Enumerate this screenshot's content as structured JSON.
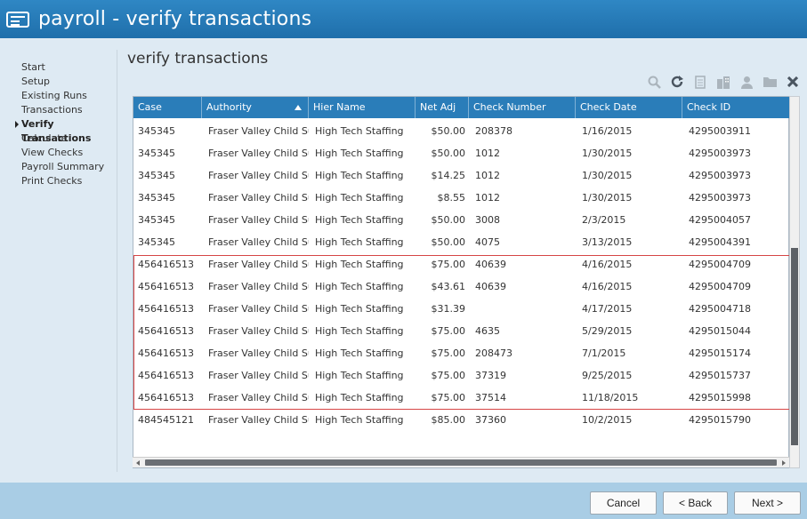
{
  "app": {
    "title": "payroll - verify transactions",
    "icon": "payroll-card-icon"
  },
  "sidebar": {
    "items": [
      {
        "label": "Start",
        "active": false
      },
      {
        "label": "Setup",
        "active": false
      },
      {
        "label": "Existing Runs",
        "active": false
      },
      {
        "label": "Transactions",
        "active": false
      },
      {
        "label": "Verify Transactions",
        "active": true
      },
      {
        "label": "Calculate",
        "active": false
      },
      {
        "label": "View Checks",
        "active": false
      },
      {
        "label": "Payroll Summary",
        "active": false
      },
      {
        "label": "Print Checks",
        "active": false
      }
    ]
  },
  "main": {
    "title": "verify transactions",
    "toolbar": {
      "icons": [
        "search-icon",
        "refresh-icon",
        "document-icon",
        "building-icon",
        "person-icon",
        "folder-icon",
        "close-icon"
      ]
    },
    "grid": {
      "columns": [
        "Case",
        "Authority",
        "Hier Name",
        "Net Adj",
        "Check Number",
        "Check Date",
        "Check ID"
      ],
      "sorted_column": "Authority",
      "rows": [
        [
          "345345",
          "Fraser Valley Child Su...",
          "High Tech Staffing",
          "$50.00",
          "208378",
          "1/16/2015",
          "4295003911"
        ],
        [
          "345345",
          "Fraser Valley Child Su...",
          "High Tech Staffing",
          "$50.00",
          "1012",
          "1/30/2015",
          "4295003973"
        ],
        [
          "345345",
          "Fraser Valley Child Su...",
          "High Tech Staffing",
          "$14.25",
          "1012",
          "1/30/2015",
          "4295003973"
        ],
        [
          "345345",
          "Fraser Valley Child Su...",
          "High Tech Staffing",
          "$8.55",
          "1012",
          "1/30/2015",
          "4295003973"
        ],
        [
          "345345",
          "Fraser Valley Child Su...",
          "High Tech Staffing",
          "$50.00",
          "3008",
          "2/3/2015",
          "4295004057"
        ],
        [
          "345345",
          "Fraser Valley Child Su...",
          "High Tech Staffing",
          "$50.00",
          "4075",
          "3/13/2015",
          "4295004391"
        ],
        [
          "456416513",
          "Fraser Valley Child Su...",
          "High Tech Staffing",
          "$75.00",
          "40639",
          "4/16/2015",
          "4295004709"
        ],
        [
          "456416513",
          "Fraser Valley Child Su...",
          "High Tech Staffing",
          "$43.61",
          "40639",
          "4/16/2015",
          "4295004709"
        ],
        [
          "456416513",
          "Fraser Valley Child Su...",
          "High Tech Staffing",
          "$31.39",
          "",
          "4/17/2015",
          "4295004718"
        ],
        [
          "456416513",
          "Fraser Valley Child Su...",
          "High Tech Staffing",
          "$75.00",
          "4635",
          "5/29/2015",
          "4295015044"
        ],
        [
          "456416513",
          "Fraser Valley Child Su...",
          "High Tech Staffing",
          "$75.00",
          "208473",
          "7/1/2015",
          "4295015174"
        ],
        [
          "456416513",
          "Fraser Valley Child Su...",
          "High Tech Staffing",
          "$75.00",
          "37319",
          "9/25/2015",
          "4295015737"
        ],
        [
          "456416513",
          "Fraser Valley Child Su...",
          "High Tech Staffing",
          "$75.00",
          "37514",
          "11/18/2015",
          "4295015998"
        ],
        [
          "484545121",
          "Fraser Valley Child Su...",
          "High Tech Staffing",
          "$85.00",
          "37360",
          "10/2/2015",
          "4295015790"
        ]
      ]
    }
  },
  "footer": {
    "cancel_label": "Cancel",
    "back_label": "< Back",
    "next_label": "Next >"
  },
  "colors": {
    "titlebar": "#2478b6",
    "grid_header": "#2a7db9",
    "highlight": "#d64545",
    "footer": "#a9cde5"
  }
}
